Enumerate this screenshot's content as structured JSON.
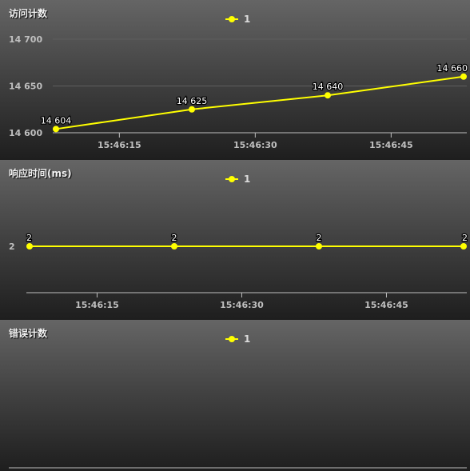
{
  "colors": {
    "series": "#ffff00",
    "axis_text": "#bfbfbf",
    "label_text": "#ffffff",
    "grid": "#5e5e5e"
  },
  "chart_data": [
    {
      "type": "line",
      "title": "访问计数",
      "legend": [
        "1"
      ],
      "legend_position": "top-center",
      "x": [
        "15:46:08",
        "15:46:23",
        "15:46:38",
        "15:46:53"
      ],
      "x_ticks": [
        "15:46:15",
        "15:46:30",
        "15:46:45"
      ],
      "x_range": [
        "15:46:08",
        "15:46:53"
      ],
      "y_ticks": [
        "14 600",
        "14 650",
        "14 700"
      ],
      "ylim": [
        14600,
        14700
      ],
      "series": [
        {
          "name": "1",
          "values": [
            14604,
            14625,
            14640,
            14660
          ],
          "labels": [
            "14 604",
            "14 625",
            "14 640",
            "14 660"
          ]
        }
      ],
      "grid": true
    },
    {
      "type": "line",
      "title": "响应时间(ms)",
      "legend": [
        "1"
      ],
      "legend_position": "top-center",
      "x": [
        "15:46:08",
        "15:46:23",
        "15:46:38",
        "15:46:53"
      ],
      "x_ticks": [
        "15:46:15",
        "15:46:30",
        "15:46:45"
      ],
      "x_range": [
        "15:46:08",
        "15:46:53"
      ],
      "y_ticks": [
        "2"
      ],
      "ylim": [
        1,
        3
      ],
      "series": [
        {
          "name": "1",
          "values": [
            2,
            2,
            2,
            2
          ],
          "labels": [
            "2",
            "2",
            "2",
            "2"
          ]
        }
      ],
      "grid": false
    },
    {
      "type": "line",
      "title": "错误计数",
      "legend": [
        "1"
      ],
      "legend_position": "top-center",
      "x": [],
      "x_ticks": [],
      "y_ticks": [],
      "series": [
        {
          "name": "1",
          "values": [],
          "labels": []
        }
      ],
      "grid": false
    }
  ]
}
